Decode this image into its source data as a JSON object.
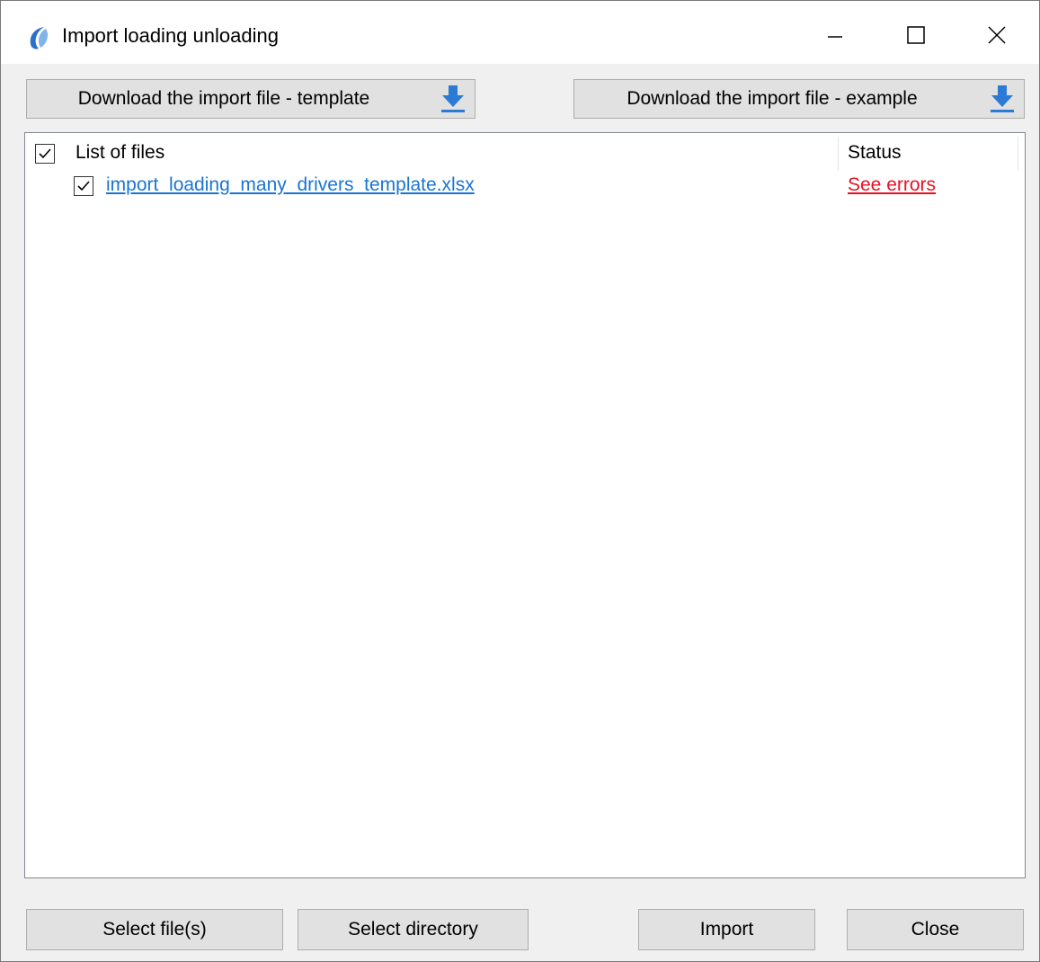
{
  "window": {
    "title": "Import loading unloading",
    "controls": {
      "minimize": "minimize-icon",
      "maximize": "maximize-icon",
      "close": "close-icon"
    }
  },
  "toolbar": {
    "download_template_label": "Download the import file - template",
    "download_example_label": "Download the import file - example",
    "download_icon": "download-icon",
    "download_icon_color": "#2b7bd6"
  },
  "file_list": {
    "header_files": "List of files",
    "header_status": "Status",
    "select_all_checked": true,
    "rows": [
      {
        "file_name": "import_loading_many_drivers_template.xlsx",
        "status": "See errors",
        "checked": true
      }
    ]
  },
  "colors": {
    "link": "#1a75d2",
    "error": "#e81123"
  },
  "footer": {
    "select_files_label": "Select file(s)",
    "select_directory_label": "Select directory",
    "import_label": "Import",
    "close_label": "Close"
  }
}
